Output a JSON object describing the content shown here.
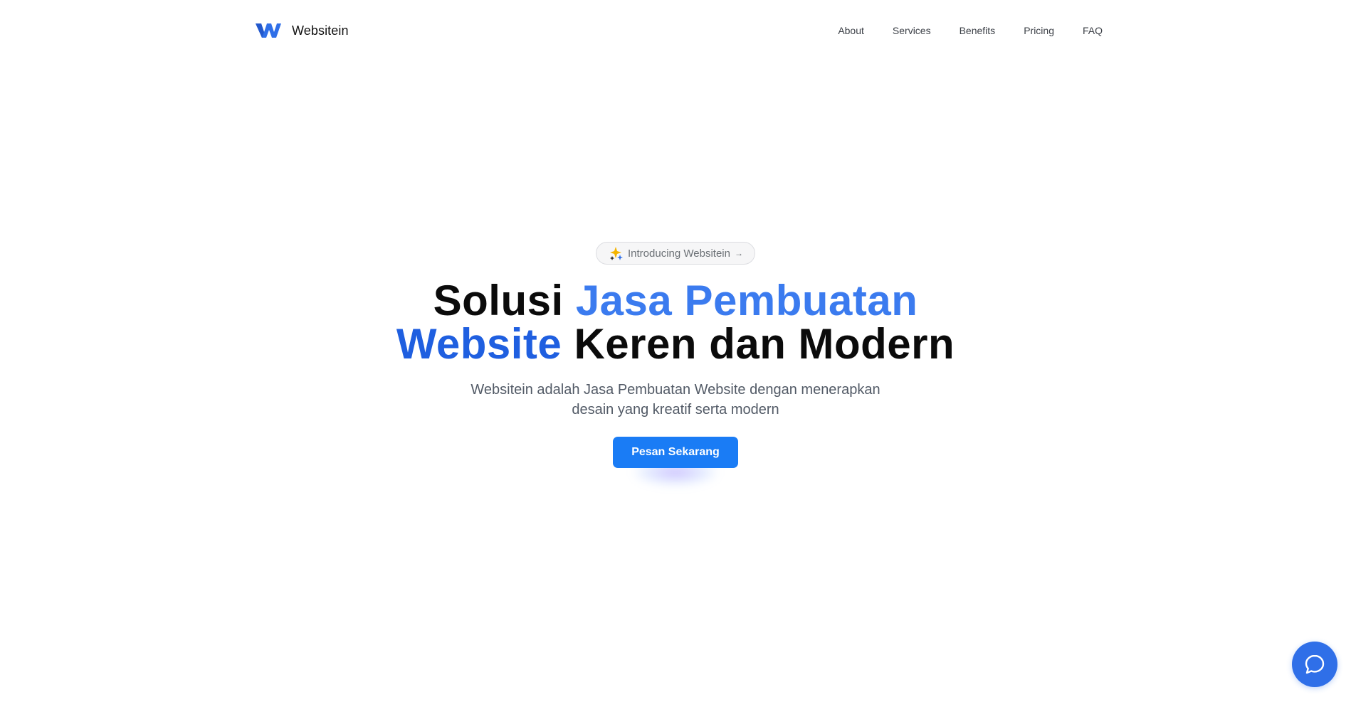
{
  "brand": {
    "name": "Websitein",
    "logo_icon": "websitein-w-logo-icon",
    "logo_color": "#2f6fe8"
  },
  "nav": {
    "items": [
      {
        "label": "About"
      },
      {
        "label": "Services"
      },
      {
        "label": "Benefits"
      },
      {
        "label": "Pricing"
      },
      {
        "label": "FAQ"
      }
    ]
  },
  "hero": {
    "pill": {
      "icon": "sparkle-icon",
      "label": "Introducing Websitein",
      "arrow": "→"
    },
    "headline": {
      "part1": "Solusi ",
      "accent1": "Jasa Pembuatan",
      "accent2": "Website",
      "part2": " Keren dan Modern"
    },
    "subtitle": {
      "line1": "Websitein adalah Jasa Pembuatan Website dengan menerapkan",
      "line2": "desain yang kreatif serta modern"
    },
    "cta_label": "Pesan Sekarang"
  },
  "chat_widget": {
    "icon": "chat-bubble-icon"
  },
  "colors": {
    "accent": "#3b7bef",
    "accent_dark": "#1f5fe0",
    "cta": "#1a7cf5",
    "text": "#0b0b0b",
    "muted": "#525a66"
  }
}
